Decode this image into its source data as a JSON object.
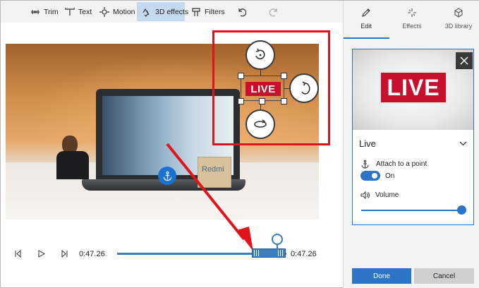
{
  "toolbar": {
    "items": [
      {
        "label": "Trim",
        "icon": "trim-icon"
      },
      {
        "label": "Text",
        "icon": "text-icon"
      },
      {
        "label": "Motion",
        "icon": "motion-icon"
      },
      {
        "label": "3D effects",
        "icon": "3d-effects-icon",
        "active": true
      },
      {
        "label": "Filters",
        "icon": "filters-icon"
      }
    ],
    "undo_icon": "undo-icon",
    "redo_icon": "redo-icon"
  },
  "preview": {
    "overlay_text": "LIVE",
    "backdrop_text": "Redmi",
    "anchor_icon": "anchor-icon"
  },
  "playback": {
    "current_time": "0:47.26",
    "end_time": "0:47.26",
    "prev_frame_icon": "previous-frame-icon",
    "play_icon": "play-icon",
    "next_frame_icon": "next-frame-icon"
  },
  "panel": {
    "tabs": [
      {
        "label": "Edit",
        "icon": "pencil-icon",
        "active": true
      },
      {
        "label": "Effects",
        "icon": "sparkle-icon"
      },
      {
        "label": "3D library",
        "icon": "cube-icon"
      }
    ],
    "card": {
      "thumbnail_text": "LIVE",
      "title": "Live",
      "attach_label": "Attach to a point",
      "attach_state": "On",
      "attach_enabled": true,
      "volume_label": "Volume",
      "volume_level": 1.0
    },
    "done_label": "Done",
    "cancel_label": "Cancel"
  },
  "colors": {
    "accent": "#2b74c7",
    "highlight_red": "#e2141b",
    "live_red": "#c8102e"
  }
}
